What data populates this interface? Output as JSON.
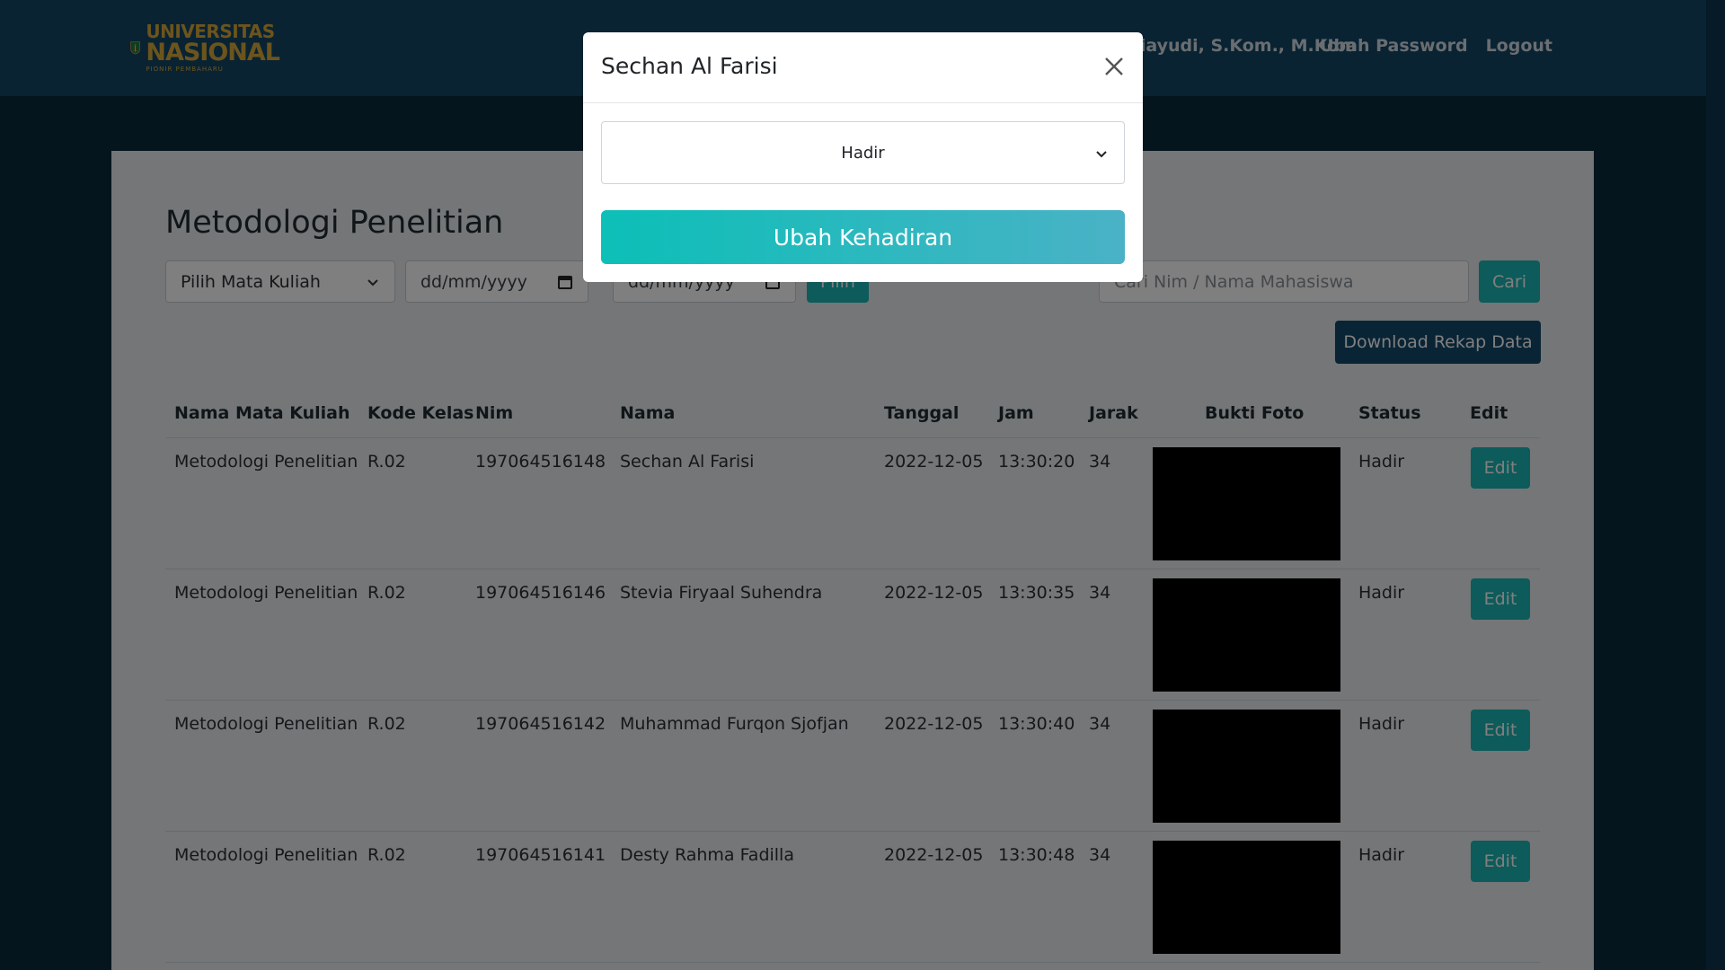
{
  "navbar": {
    "logo": {
      "line1": "UNIVERSITAS",
      "line2": "NASIONAL",
      "line3": "PIONIR PEMBAHARU"
    },
    "user_name": "Agung Triayudi, S.Kom., M.Kom",
    "change_password": "Ubah Password",
    "logout": "Logout"
  },
  "page": {
    "title": "Metodologi Penelitian",
    "course_select": "Pilih Mata Kuliah",
    "date_from_placeholder": "dd/mm/yyyy",
    "date_to_placeholder": "dd/mm/yyyy",
    "filter_button": "Pilih",
    "search_placeholder": "Cari Nim / Nama Mahasiswa",
    "search_button": "Cari",
    "download_button": "Download Rekap Data"
  },
  "table": {
    "headers": [
      "Nama Mata Kuliah",
      "Kode Kelas",
      "Nim",
      "Nama",
      "Tanggal",
      "Jam",
      "Jarak",
      "Bukti Foto",
      "Status",
      "Edit"
    ],
    "rows": [
      {
        "course": "Metodologi Penelitian",
        "class": "R.02",
        "nim": "197064516148",
        "name": "Sechan Al Farisi",
        "date": "2022-12-05",
        "time": "13:30:20",
        "distance": "34",
        "status": "Hadir",
        "edit": "Edit"
      },
      {
        "course": "Metodologi Penelitian",
        "class": "R.02",
        "nim": "197064516146",
        "name": "Stevia Firyaal Suhendra",
        "date": "2022-12-05",
        "time": "13:30:35",
        "distance": "34",
        "status": "Hadir",
        "edit": "Edit"
      },
      {
        "course": "Metodologi Penelitian",
        "class": "R.02",
        "nim": "197064516142",
        "name": "Muhammad Furqon Sjofjan",
        "date": "2022-12-05",
        "time": "13:30:40",
        "distance": "34",
        "status": "Hadir",
        "edit": "Edit"
      },
      {
        "course": "Metodologi Penelitian",
        "class": "R.02",
        "nim": "197064516141",
        "name": "Desty Rahma Fadilla",
        "date": "2022-12-05",
        "time": "13:30:48",
        "distance": "34",
        "status": "Hadir",
        "edit": "Edit"
      }
    ]
  },
  "modal": {
    "title": "Sechan Al Farisi",
    "status_selected": "Hadir",
    "submit_button": "Ubah Kehadiran"
  },
  "colors": {
    "navbar": "#124767",
    "accent": "#1bb7b5",
    "download": "#13496a"
  }
}
